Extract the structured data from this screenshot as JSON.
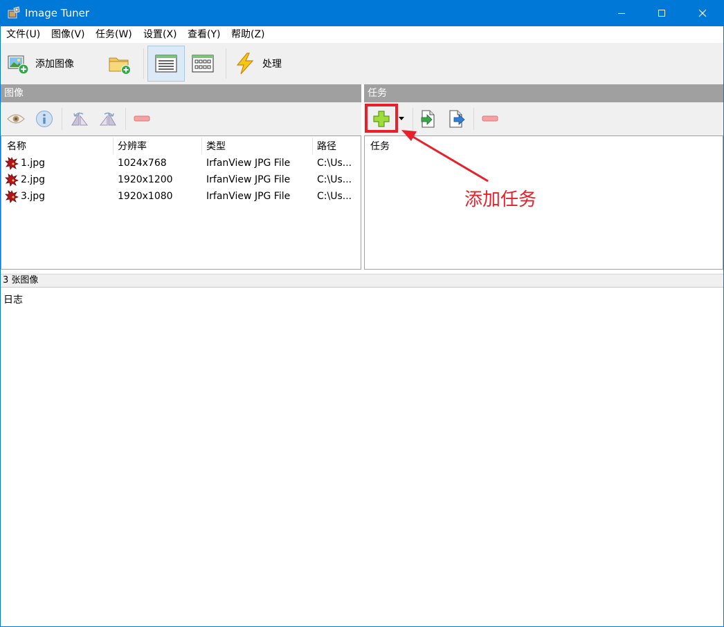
{
  "window": {
    "title": "Image Tuner"
  },
  "menu": [
    "文件(U)",
    "图像(V)",
    "任务(W)",
    "设置(X)",
    "查看(Y)",
    "帮助(Z)"
  ],
  "toolbar": {
    "add_images_label": "添加图像",
    "process_label": "处理"
  },
  "images_panel": {
    "header": "图像",
    "columns": [
      "名称",
      "分辨率",
      "类型",
      "路径"
    ],
    "rows": [
      {
        "name": "1.jpg",
        "resolution": "1024x768",
        "type": "IrfanView JPG File",
        "path": "C:\\Us..."
      },
      {
        "name": "2.jpg",
        "resolution": "1920x1200",
        "type": "IrfanView JPG File",
        "path": "C:\\Us..."
      },
      {
        "name": "3.jpg",
        "resolution": "1920x1080",
        "type": "IrfanView JPG File",
        "path": "C:\\Us..."
      }
    ]
  },
  "tasks_panel": {
    "header": "任务",
    "column": "任务"
  },
  "status": {
    "image_count": "3 张图像"
  },
  "log": {
    "label": "日志"
  },
  "annotation": {
    "text": "添加任务",
    "color": "#e8202a"
  },
  "colors": {
    "titlebar": "#0078d7",
    "panel_header": "#a0a0a0"
  },
  "icons": {
    "title": "image-tuner-app-icon",
    "toolbar": [
      "add-image-icon",
      "add-folder-icon",
      "details-view-icon",
      "thumbnail-view-icon",
      "lightning-process-icon"
    ],
    "images": [
      "eye-preview-icon",
      "info-icon",
      "rotate-left-icon",
      "rotate-right-icon",
      "remove-icon"
    ],
    "tasks": [
      "add-task-plus-icon",
      "dropdown-arrow-icon",
      "import-task-icon",
      "export-task-icon",
      "remove-task-icon"
    ]
  }
}
